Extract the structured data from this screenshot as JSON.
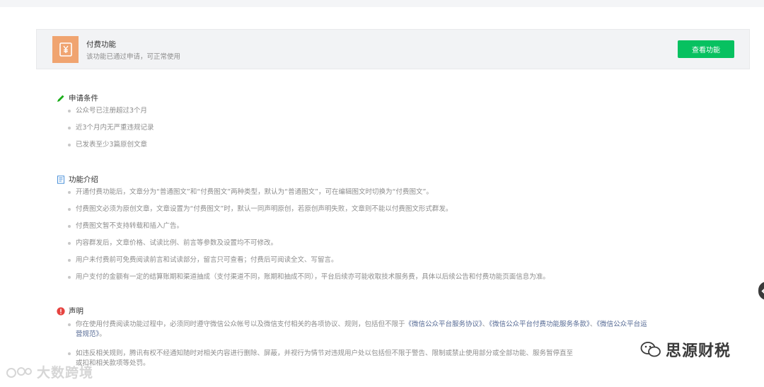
{
  "feature": {
    "title": "付费功能",
    "status": "该功能已通过申请，可正常使用",
    "button_label": "查看功能"
  },
  "requirements": {
    "title": "申请条件",
    "items": [
      "公众号已注册超过3个月",
      "近3个月内无严重违规记录",
      "已发表至少3篇原创文章"
    ]
  },
  "intro": {
    "title": "功能介绍",
    "items": [
      "开通付费功能后，文章分为“普通图文”和“付费图文”两种类型，默认为“普通图文”，可在编辑图文时切换为“付费图文”。",
      "付费图文必须为原创文章，文章设置为“付费图文”时，默认一同声明原创，若原创声明失败，文章则不能以付费图文形式群发。",
      "付费图文暂不支持转载和插入广告。",
      "内容群发后，文章价格、试读比例、前言等参数及设置均不可修改。",
      "用户未付费前可免费阅读前言和试读部分，留言只可查看；付费后可阅读全文、写留言。",
      "用户支付的金额有一定的结算账期和渠道抽成（支付渠道不同，账期和抽成不同），平台后续亦可能收取技术服务费，具体以后续公告和付费功能页面信息为准。"
    ]
  },
  "declaration": {
    "title": "声明",
    "item1_prefix": "你在使用付费阅读功能过程中，必须同时遵守微信公众帐号以及微信支付相关的各项协议、规则，包括但不限于",
    "item1_link1": "《微信公众平台服务协议》",
    "item1_sep1": "、",
    "item1_link2": "《微信公众平台付费功能服务条款》",
    "item1_sep2": "、",
    "item1_link3a": "《微信公众平台运",
    "item1_link3b": "营规范》",
    "item1_suffix": "。",
    "item2_line1": "如违反相关规则，腾讯有权不经通知随时对相关内容进行删除、屏蔽，并视行为情节对违规用户处以包括但不限于警告、限制或禁止使用部分或全部功能、服务暂停直至",
    "item2_line2": "或扣和相关款项等处罚。"
  },
  "watermarks": {
    "left": "大数跨境",
    "right": "思源财税"
  },
  "colors": {
    "accent_green": "#07c160",
    "icon_orange": "#f0a470",
    "link_blue": "#576b95",
    "alert_red": "#e64340"
  }
}
